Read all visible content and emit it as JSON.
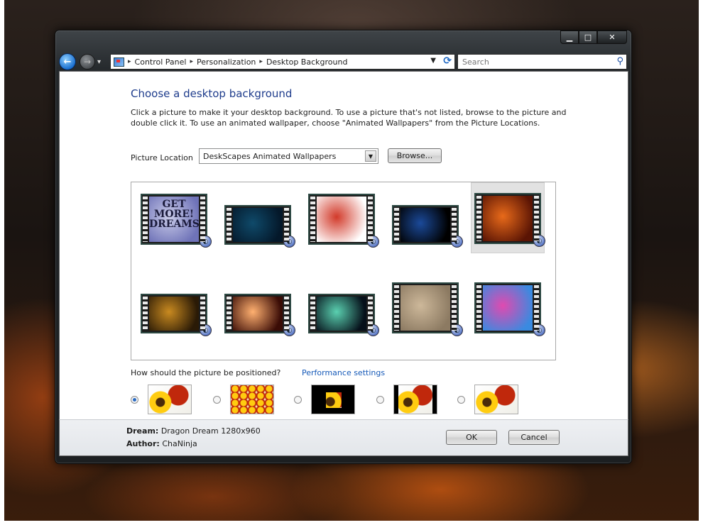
{
  "window": {
    "caption": {
      "minimize": "▁",
      "maximize": "□",
      "close": "✕"
    }
  },
  "nav": {
    "back_icon": "←",
    "forward_icon": "→",
    "history_dropdown": "▾",
    "breadcrumbs": [
      "Control Panel",
      "Personalization",
      "Desktop Background"
    ],
    "breadcrumb_separator": "▸"
  },
  "search": {
    "placeholder": "Search"
  },
  "page": {
    "title": "Choose a desktop background",
    "description": "Click a picture to make it your desktop background. To use a picture that's not listed, browse to the picture and double click it. To use an animated wallpaper, choose \"Animated Wallpapers\" from the Picture Locations."
  },
  "location": {
    "label": "Picture Location",
    "value": "DeskScapes Animated Wallpapers",
    "browse_label": "Browse..."
  },
  "wallpapers": [
    {
      "name": "get-more-dreams",
      "label": "GET MORE! DREAMS",
      "colors": [
        "#c9cbe8",
        "#6f73b8"
      ],
      "selected": false
    },
    {
      "name": "underwater",
      "colors": [
        "#0f4a6a",
        "#04182a"
      ],
      "selected": false
    },
    {
      "name": "cube-logo",
      "colors": [
        "#d23a2a",
        "#ffffff"
      ],
      "selected": false
    },
    {
      "name": "earth",
      "colors": [
        "#1b4a9a",
        "#000000"
      ],
      "selected": false
    },
    {
      "name": "dragon-dream",
      "colors": [
        "#e86a1a",
        "#5a1404"
      ],
      "selected": true
    },
    {
      "name": "sunset-rays",
      "colors": [
        "#c98a20",
        "#2a1a06"
      ],
      "selected": false
    },
    {
      "name": "firework",
      "colors": [
        "#ffb070",
        "#3a0c06"
      ],
      "selected": false
    },
    {
      "name": "light-streaks",
      "colors": [
        "#5ad0b0",
        "#06101a"
      ],
      "selected": false
    },
    {
      "name": "sand",
      "colors": [
        "#cdb89a",
        "#8c7a62"
      ],
      "selected": false
    },
    {
      "name": "color-swirl",
      "colors": [
        "#e04ab0",
        "#3a8ae0"
      ],
      "selected": false
    }
  ],
  "positioning": {
    "question": "How should the picture be positioned?",
    "performance_link": "Performance settings",
    "options": [
      {
        "name": "stretch",
        "selected": true
      },
      {
        "name": "tile",
        "selected": false
      },
      {
        "name": "center",
        "selected": false
      },
      {
        "name": "fit",
        "selected": false
      },
      {
        "name": "fill",
        "selected": false
      }
    ]
  },
  "footer": {
    "dream_label": "Dream:",
    "dream_value": "Dragon Dream 1280x960",
    "author_label": "Author:",
    "author_value": "ChaNinja",
    "ok_label": "OK",
    "cancel_label": "Cancel"
  },
  "icons": {
    "refresh": "refresh-icon",
    "search": "search-icon",
    "control_panel": "control-panel-icon"
  }
}
